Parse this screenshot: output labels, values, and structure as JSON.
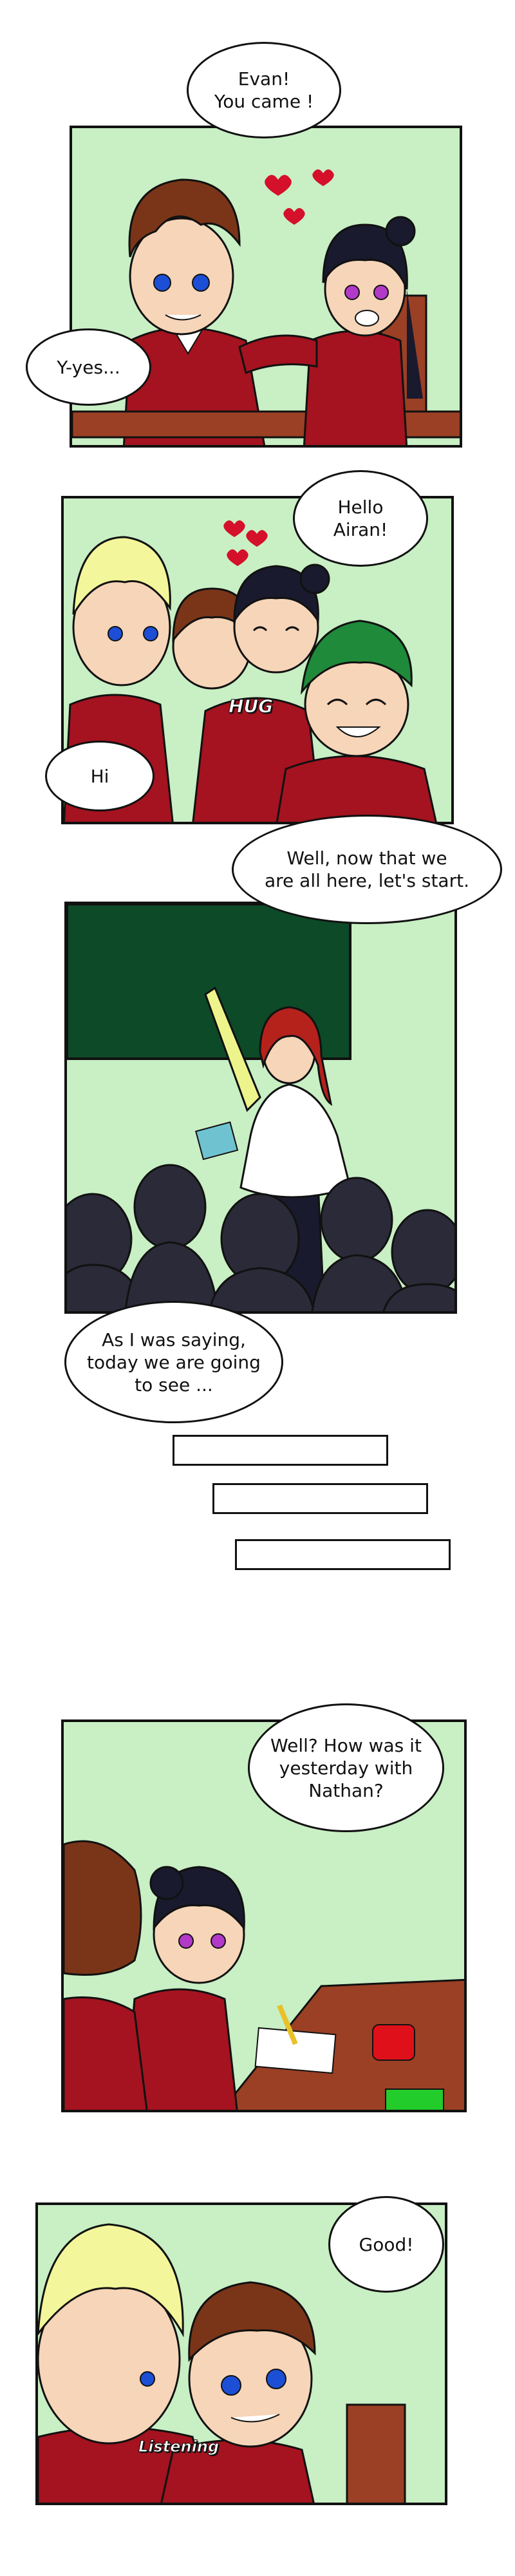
{
  "panels": [
    {
      "bubbles": [
        {
          "text": "Evan!\nYou came !"
        },
        {
          "text": "Y-yes..."
        }
      ]
    },
    {
      "bubbles": [
        {
          "text": "Hello\nAiran!"
        },
        {
          "text": "Hi"
        },
        {
          "text": "Well, now that we\nare all here, let's start."
        }
      ],
      "sfx": "HUG"
    },
    {
      "bubbles": [
        {
          "text": "As I was saying,\ntoday we are going\nto see ..."
        }
      ]
    },
    {
      "bubbles": [
        {
          "text": "Well? How was it\nyesterday with\nNathan?"
        }
      ]
    },
    {
      "bubbles": [
        {
          "text": "Good!"
        }
      ],
      "sfx": "Listening"
    }
  ],
  "colors": {
    "panel_bg": "#c9efc4",
    "uniform": "#a4131f",
    "chalkboard": "#0d4a28",
    "heart": "#d4102a"
  }
}
